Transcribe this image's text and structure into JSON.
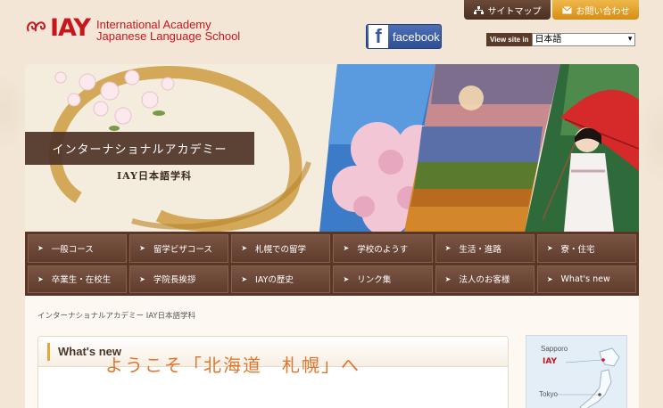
{
  "header": {
    "logo_mark": "IAY",
    "logo_line1": "International Academy",
    "logo_line2": "Japanese Language School",
    "sitemap_label": "サイトマップ",
    "contact_label": "お問い合わせ",
    "facebook_label": "facebook",
    "lang_label": "View site in",
    "lang_value": "日本語"
  },
  "hero": {
    "title": "インターナショナルアカデミー",
    "subtitle": "IAY日本語学科"
  },
  "nav": {
    "items": [
      {
        "label": "一般コース"
      },
      {
        "label": "留学ビザコース"
      },
      {
        "label": "札幌での留学"
      },
      {
        "label": "学校のようす"
      },
      {
        "label": "生活・進路"
      },
      {
        "label": "寮・住宅"
      },
      {
        "label": "卒業生・在校生"
      },
      {
        "label": "学院長挨拶"
      },
      {
        "label": "IAYの歴史"
      },
      {
        "label": "リンク集"
      },
      {
        "label": "法人のお客様"
      },
      {
        "label": "What's new"
      }
    ]
  },
  "main": {
    "breadcrumb": "インターナショナルアカデミー IAY日本語学科",
    "news_heading": "What's new",
    "welcome": "ようこそ「北海道　札幌」へ"
  },
  "map": {
    "sapporo": "Sapporo",
    "iay": "IAY",
    "tokyo": "Tokyo"
  },
  "colors": {
    "brand_red": "#c8161d",
    "nav_brown": "#5a3627",
    "accent_orange": "#e0762d",
    "contact_gold": "#e2a230"
  },
  "icons": {
    "sitemap": "sitemap-icon",
    "contact": "mail-icon",
    "facebook": "facebook-icon",
    "nav_arrow": "arrow-right-icon"
  }
}
